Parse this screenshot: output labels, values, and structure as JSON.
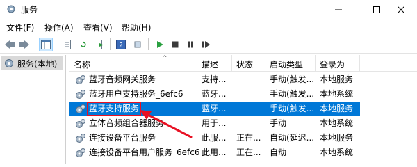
{
  "window": {
    "title": "服务"
  },
  "menu": [
    "文件(F)",
    "操作(A)",
    "查看(V)",
    "帮助(H)"
  ],
  "toolbar": {
    "icons": [
      "back-icon",
      "forward-icon",
      "console-tree-icon",
      "properties-icon",
      "refresh-icon",
      "export-icon",
      "help-icon",
      "view-icon",
      "start-icon",
      "stop-icon",
      "pause-icon",
      "restart-icon"
    ]
  },
  "tree": {
    "label": "服务(本地)"
  },
  "columns": [
    "名称",
    "描述",
    "状态",
    "启动类型",
    "登录为"
  ],
  "services": [
    {
      "name": "蓝牙音频网关服务",
      "desc": "支持...",
      "status": "",
      "startup": "手动(触发...",
      "logon": "本地服务",
      "selected": false
    },
    {
      "name": "蓝牙用户支持服务_6efc6",
      "desc": "蓝牙...",
      "status": "",
      "startup": "手动(触发...",
      "logon": "本地系统",
      "selected": false
    },
    {
      "name": "蓝牙支持服务",
      "desc": "蓝牙...",
      "status": "",
      "startup": "手动(触发...",
      "logon": "本地服务",
      "selected": true
    },
    {
      "name": "立体音频组合器服务",
      "desc": "用于...",
      "status": "",
      "startup": "手动",
      "logon": "本地系统",
      "selected": false
    },
    {
      "name": "连接设备平台服务",
      "desc": "此服...",
      "status": "正在...",
      "startup": "自动(延迟...",
      "logon": "本地服务",
      "selected": false
    },
    {
      "name": "连接设备平台用户服务_6efc6",
      "desc": "此用...",
      "status": "正在...",
      "startup": "自动",
      "logon": "本地系统",
      "selected": false
    }
  ],
  "colors": {
    "selection": "#0078d7",
    "highlight_box": "#e81123",
    "annotation_arrow": "#e81123"
  }
}
